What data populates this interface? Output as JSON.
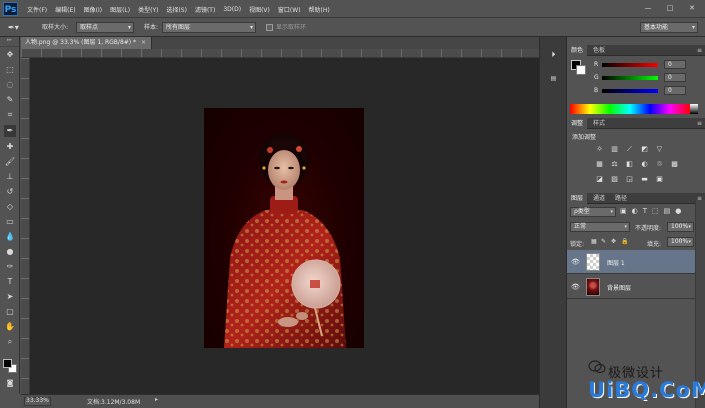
{
  "app": {
    "logo": "Ps"
  },
  "menu": [
    "文件(F)",
    "编辑(E)",
    "图像(I)",
    "图层(L)",
    "类型(Y)",
    "选择(S)",
    "滤镜(T)",
    "3D(D)",
    "视图(V)",
    "窗口(W)",
    "帮助(H)"
  ],
  "window_controls": {
    "minimize": "—",
    "maximize": "□",
    "close": "✕"
  },
  "options_bar": {
    "sample_size_label": "取样大小:",
    "sample_size_value": "取样点",
    "sample_label": "样本:",
    "sample_value": "所有图层",
    "show_ring_label": "显示取样环",
    "workspace_value": "基本功能"
  },
  "document": {
    "tab_title": "人物.png @ 33.3% (图层 1, RGB/8#) *",
    "tab_close": "×",
    "zoom": "33.33%",
    "doc_info": "文档:3.12M/3.08M",
    "status_arrow": "▸"
  },
  "tools": [
    "move-tool-icon",
    "marquee-tool-icon",
    "lasso-tool-icon",
    "quick-select-tool-icon",
    "crop-tool-icon",
    "eyedropper-tool-icon",
    "spot-heal-tool-icon",
    "brush-tool-icon",
    "clone-stamp-tool-icon",
    "history-brush-tool-icon",
    "eraser-tool-icon",
    "gradient-tool-icon",
    "blur-tool-icon",
    "dodge-tool-icon",
    "pen-tool-icon",
    "type-tool-icon",
    "path-select-tool-icon",
    "rectangle-tool-icon",
    "hand-tool-icon",
    "zoom-tool-icon"
  ],
  "panels": {
    "color": {
      "tab_color": "颜色",
      "tab_swatches": "色板",
      "r_label": "R",
      "r_value": "0",
      "g_label": "G",
      "g_value": "0",
      "b_label": "B",
      "b_value": "0"
    },
    "adjustments": {
      "tab_adjust": "调整",
      "tab_styles": "样式",
      "title": "添加调整"
    },
    "layers": {
      "tab_layers": "图层",
      "tab_channels": "通道",
      "tab_paths": "路径",
      "filter_kind": "ρ类型",
      "blend_mode": "正常",
      "opacity_label": "不透明度:",
      "opacity_value": "100%",
      "lock_label": "锁定:",
      "fill_label": "填充:",
      "fill_value": "100%",
      "items": [
        {
          "name": "图层 1",
          "selected": true
        },
        {
          "name": "背景图层",
          "selected": false
        }
      ]
    }
  },
  "watermark": {
    "brand": "极微设计",
    "site": "UiBQ.CoM"
  },
  "colors": {
    "selected_layer": "#67758a",
    "canvas_bg": "#282828",
    "watermark_blue": "#2a7ad9"
  }
}
